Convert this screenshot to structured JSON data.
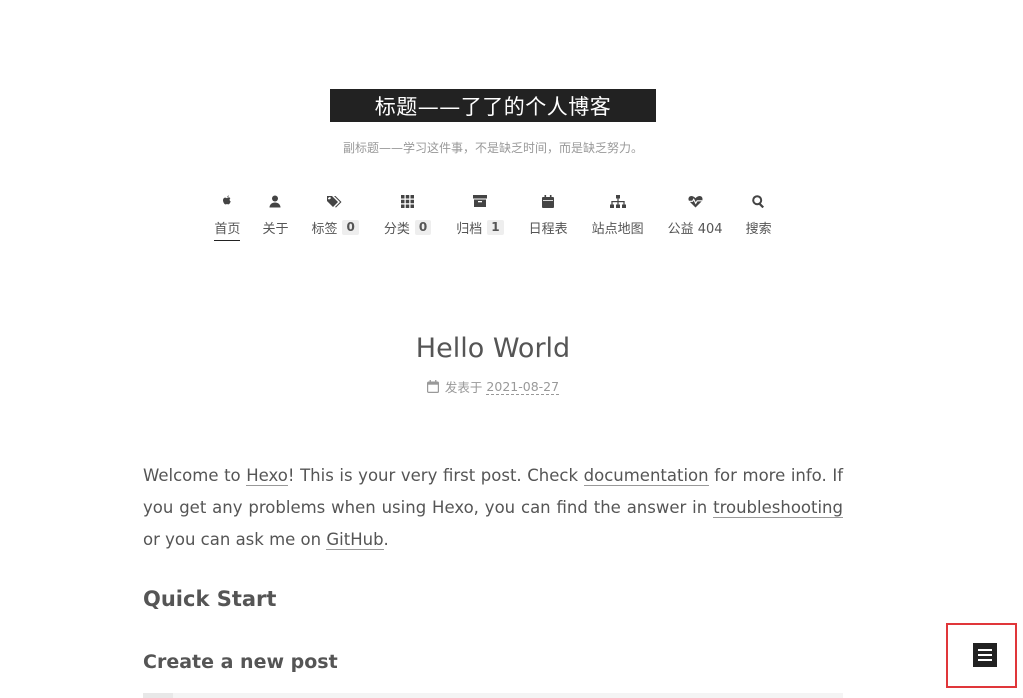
{
  "site": {
    "title": "标题——了了的个人博客",
    "subtitle": "副标题——学习这件事，不是缺乏时间，而是缺乏努力。"
  },
  "menu": {
    "items": [
      {
        "label": "首页",
        "icon": "apple-icon",
        "active": true
      },
      {
        "label": "关于",
        "icon": "user-icon"
      },
      {
        "label": "标签",
        "icon": "tags-icon",
        "badge": "0"
      },
      {
        "label": "分类",
        "icon": "grid-icon",
        "badge": "0"
      },
      {
        "label": "归档",
        "icon": "archive-icon",
        "badge": "1"
      },
      {
        "label": "日程表",
        "icon": "calendar-icon"
      },
      {
        "label": "站点地图",
        "icon": "sitemap-icon"
      },
      {
        "label": "公益 404",
        "icon": "heartbeat-icon"
      },
      {
        "label": "搜索",
        "icon": "search-icon"
      }
    ]
  },
  "post": {
    "title": "Hello World",
    "meta_prefix": "发表于",
    "date": "2021-08-27",
    "intro": {
      "t1": "Welcome to ",
      "link_hexo": "Hexo",
      "t2": "! This is your very first post. Check ",
      "link_docs": "documentation",
      "t3": " for more info. If you get any problems when using Hexo, you can find the answer in ",
      "link_trouble": "troubleshooting",
      "t4": " or you can ask me on ",
      "link_github": "GitHub",
      "t5": "."
    },
    "h2": "Quick Start",
    "h3": "Create a new post"
  },
  "colors": {
    "header_bg": "#222222",
    "highlight_border": "#e0363a"
  }
}
